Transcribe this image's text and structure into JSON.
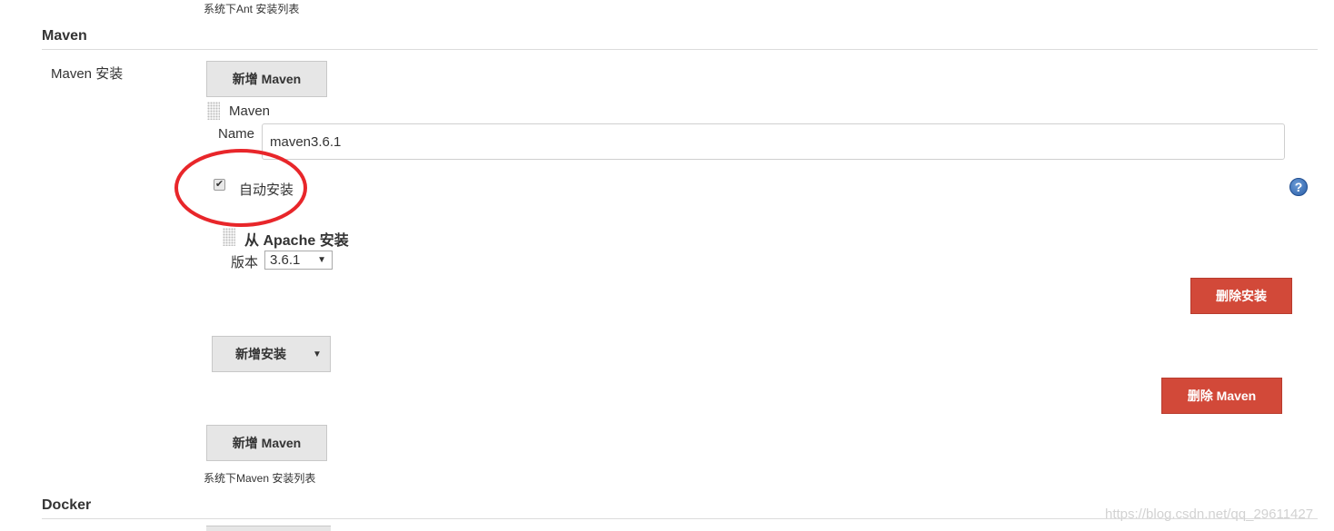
{
  "ant": {
    "note": "系统下Ant 安装列表"
  },
  "maven": {
    "section_title": "Maven",
    "installations_label": "Maven 安装",
    "add_top_label": "新增 Maven",
    "block_title": "Maven",
    "name_label": "Name",
    "name_value": "maven3.6.1",
    "auto_install_label": "自动安装",
    "auto_install_checked": "✔",
    "installer_title": "从 Apache 安装",
    "version_label": "版本",
    "version_value": "3.6.1",
    "delete_installer_label": "删除安装",
    "add_installer_label": "新增安装",
    "delete_maven_label": "删除 Maven",
    "add_bottom_label": "新增 Maven",
    "note": "系统下Maven 安装列表"
  },
  "docker": {
    "section_title": "Docker"
  },
  "watermark": "https://blog.csdn.net/qq_29611427",
  "colors": {
    "delete_red": "#d24939",
    "highlight_circle": "#e8262a",
    "help_blue": "#2b5fa8"
  },
  "icons": {
    "drag": "drag-handle-icon",
    "help": "help-icon",
    "dropdown": "caret-down-icon"
  }
}
